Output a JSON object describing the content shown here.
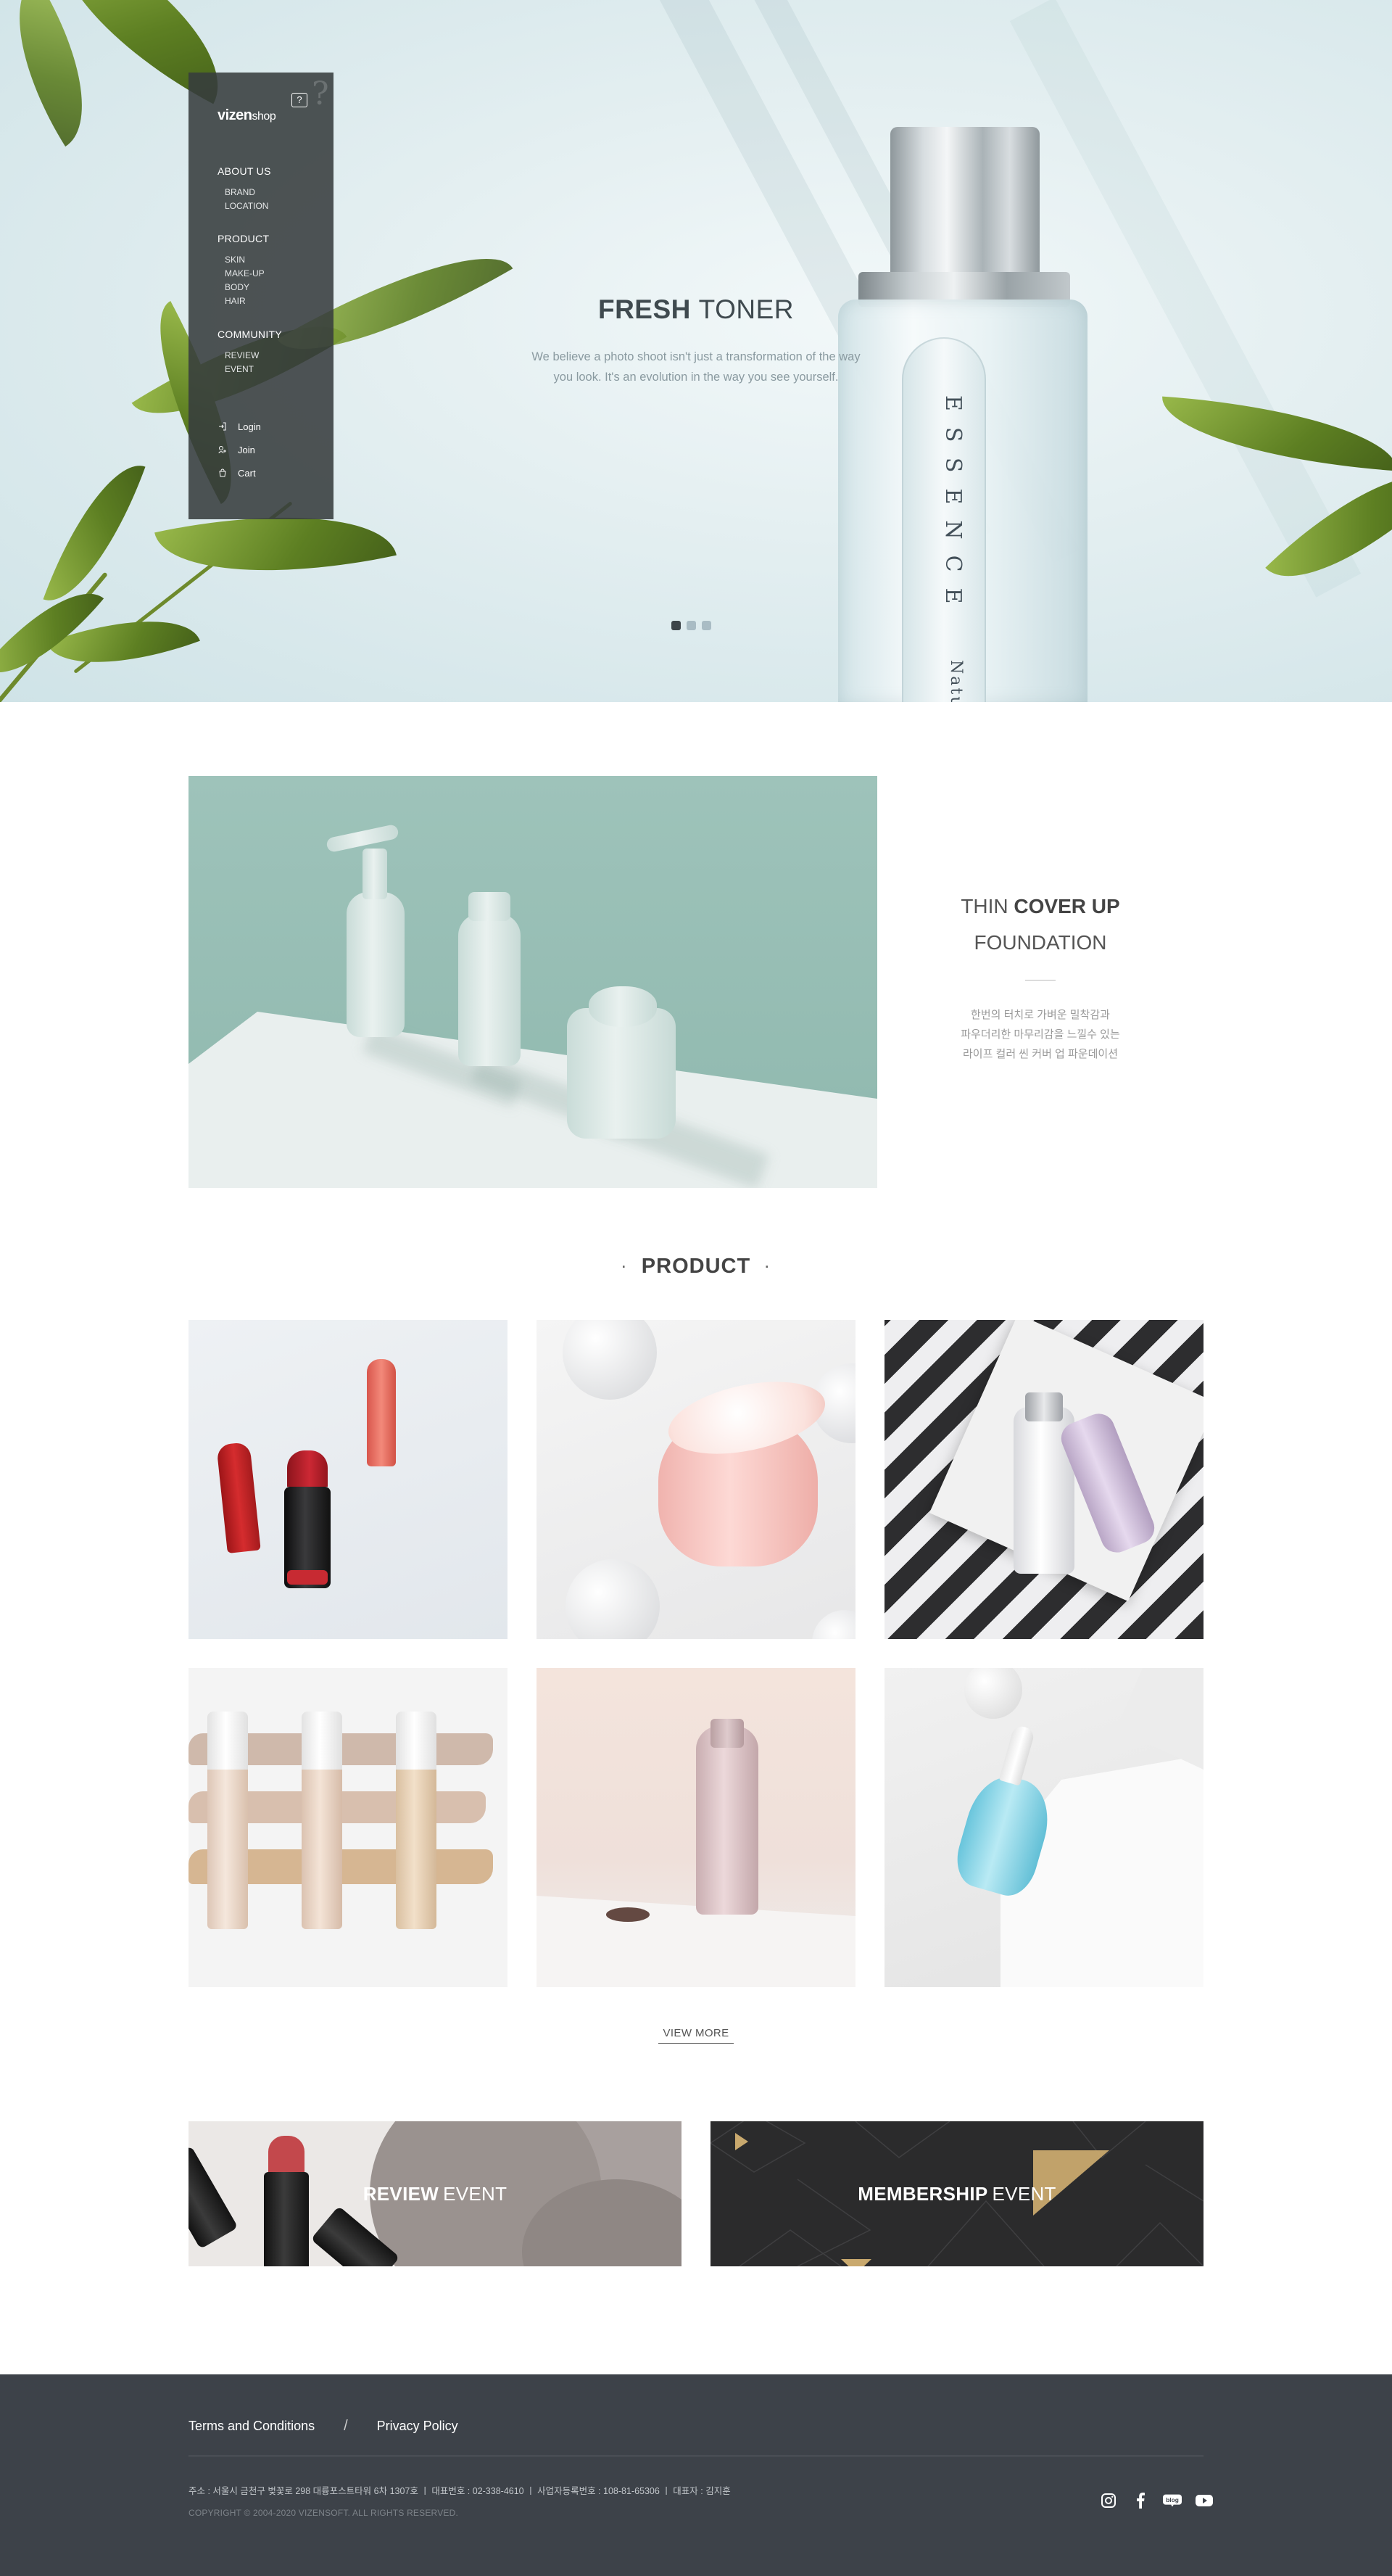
{
  "brand": {
    "logo_main": "vizen",
    "logo_sub": "shop",
    "logo_badge": "?"
  },
  "side_nav": {
    "groups": [
      {
        "title": "ABOUT US",
        "items": [
          "BRAND",
          "LOCATION"
        ]
      },
      {
        "title": "PRODUCT",
        "items": [
          "SKIN",
          "MAKE-UP",
          "BODY",
          "HAIR"
        ]
      },
      {
        "title": "COMMUNITY",
        "items": [
          "REVIEW",
          "EVENT"
        ]
      }
    ],
    "utility": [
      {
        "label": "Login",
        "icon": "login-icon"
      },
      {
        "label": "Join",
        "icon": "join-icon"
      },
      {
        "label": "Cart",
        "icon": "cart-icon"
      }
    ]
  },
  "hero": {
    "title_bold": "FRESH",
    "title_light": "TONER",
    "description_line1": "We believe a photo shoot isn't just a transformation of the way",
    "description_line2": "you look. It's an evolution in the way you see yourself.",
    "bottle_text": "ESSENCE",
    "bottle_text2": "Natu",
    "slides": 3,
    "active_slide": 1
  },
  "feature": {
    "line1_light": "THIN",
    "line1_bold": "COVER UP",
    "line2": "FOUNDATION",
    "desc_lines": [
      "한번의 터치로 가벼운 밀착감과",
      "파우더리한 마무리감을 느낄수 있는",
      "라이프 컬러 씬 커버 업 파운데이션"
    ]
  },
  "product_section": {
    "title": "PRODUCT",
    "bullet": "·",
    "items": [
      {
        "name": "product-lipsticks"
      },
      {
        "name": "product-cream-jar"
      },
      {
        "name": "product-bottles-stripes"
      },
      {
        "name": "product-concealers"
      },
      {
        "name": "product-pink-bottle"
      },
      {
        "name": "product-dropper"
      }
    ],
    "view_more": "VIEW MORE"
  },
  "events": [
    {
      "bold": "REVIEW",
      "light": "EVENT"
    },
    {
      "bold": "MEMBERSHIP",
      "light": "EVENT"
    }
  ],
  "footer": {
    "links": [
      "Terms and Conditions",
      "Privacy Policy"
    ],
    "separator": "/",
    "address": "주소 : 서울시 금천구 벚꽃로 298 대륭포스트타워 6차 1307호  ㅣ  대표번호 : 02-338-4610  ㅣ  사업자등록번호 : 108-81-65306  ㅣ  대표자 : 김지훈",
    "copyright": "COPYRIGHT © 2004-2020 VIZENSOFT. ALL RIGHTS RESERVED.",
    "social": [
      "instagram-icon",
      "facebook-icon",
      "blog-icon",
      "youtube-icon"
    ],
    "blog_glyph": "blog"
  },
  "colors": {
    "dark_panel": "#3d4249",
    "accent_gold": "#c9a96e",
    "mint": "#9ec3ba"
  }
}
